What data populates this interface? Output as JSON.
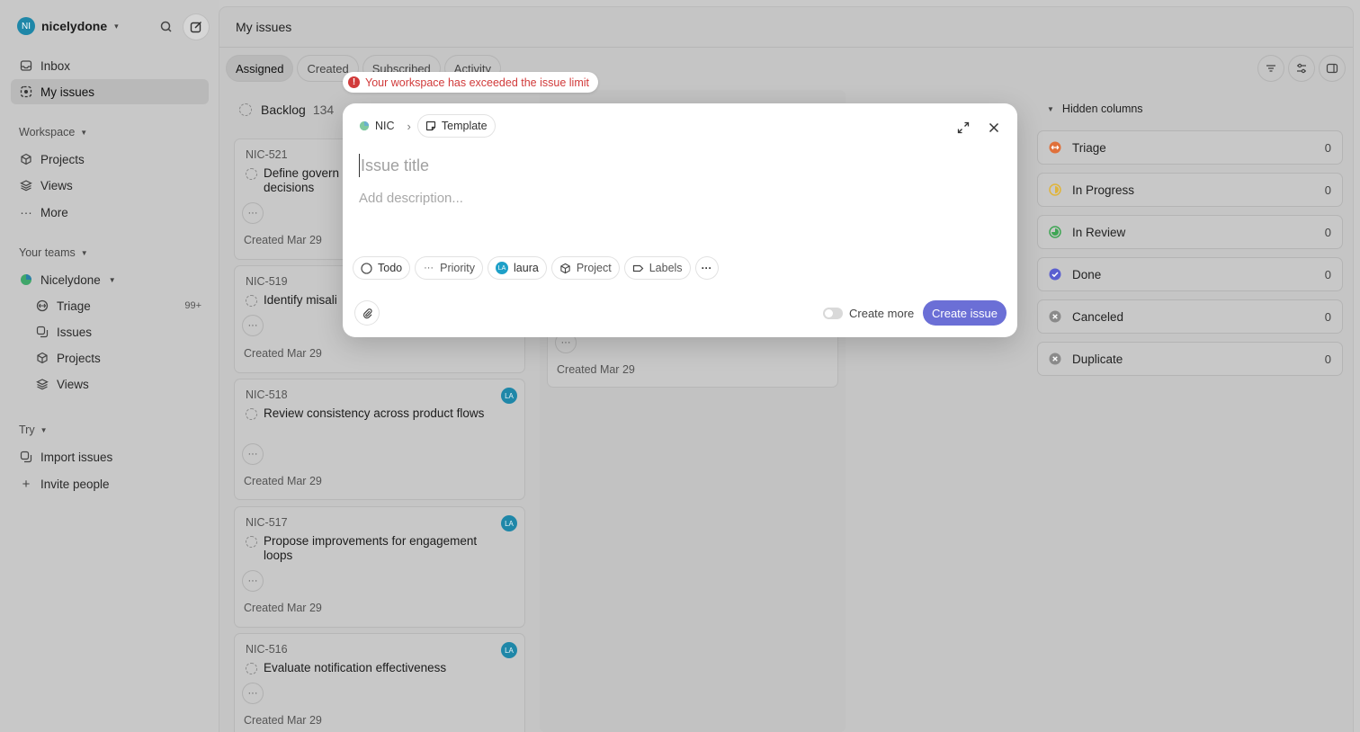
{
  "workspace": {
    "avatar": "NI",
    "name": "nicelydone"
  },
  "sidebar": {
    "top": [
      {
        "label": "Inbox"
      },
      {
        "label": "My issues"
      }
    ],
    "workspace_section": {
      "label": "Workspace",
      "items": [
        {
          "label": "Projects"
        },
        {
          "label": "Views"
        },
        {
          "label": "More"
        }
      ]
    },
    "teams_section": {
      "label": "Your teams",
      "team": "Nicelydone",
      "items": [
        {
          "label": "Triage",
          "badge": "99+"
        },
        {
          "label": "Issues"
        },
        {
          "label": "Projects"
        },
        {
          "label": "Views"
        }
      ]
    },
    "try_section": {
      "label": "Try",
      "items": [
        {
          "label": "Import issues"
        },
        {
          "label": "Invite people"
        }
      ]
    }
  },
  "main": {
    "title": "My issues",
    "tabs": [
      {
        "label": "Assigned"
      },
      {
        "label": "Created"
      },
      {
        "label": "Subscribed"
      },
      {
        "label": "Activity"
      }
    ],
    "backlog": {
      "label": "Backlog",
      "count": "134"
    },
    "cards": [
      {
        "id": "NIC-521",
        "title": "Define governance decisions",
        "title_visible": "Define govern",
        "title_line2": "decisions",
        "date": "Created Mar 29",
        "avatar": ""
      },
      {
        "id": "NIC-519",
        "title_visible": "Identify misali",
        "date": "Created Mar 29",
        "avatar": ""
      },
      {
        "id": "NIC-518",
        "title": "Review consistency across product flows",
        "date": "Created Mar 29",
        "avatar": "LA"
      },
      {
        "id": "NIC-517",
        "title": "Propose improvements for engagement loops",
        "date": "Created Mar 29",
        "avatar": "LA"
      },
      {
        "id": "NIC-516",
        "title": "Evaluate notification effectiveness",
        "date": "Created Mar 29",
        "avatar": "LA"
      }
    ],
    "col2_card_date": "Created Mar 29",
    "hidden_columns": {
      "label": "Hidden columns",
      "items": [
        {
          "label": "Triage",
          "count": "0",
          "color": "#e0703a"
        },
        {
          "label": "In Progress",
          "count": "0",
          "color": "#e0b43a"
        },
        {
          "label": "In Review",
          "count": "0",
          "color": "#3fa654"
        },
        {
          "label": "Done",
          "count": "0",
          "color": "#5a5fd0"
        },
        {
          "label": "Canceled",
          "count": "0",
          "color": "#8a8a8a"
        },
        {
          "label": "Duplicate",
          "count": "0",
          "color": "#8a8a8a"
        }
      ]
    }
  },
  "alert": {
    "text": "Your workspace has exceeded the issue limit",
    "color": "#d13a3a"
  },
  "modal": {
    "team": "NIC",
    "template": "Template",
    "title_placeholder": "Issue title",
    "description_placeholder": "Add description...",
    "props": {
      "status": "Todo",
      "priority": "Priority",
      "assignee_avatar": "LA",
      "assignee": "laura",
      "project": "Project",
      "labels": "Labels"
    },
    "create_more": "Create more",
    "create_button": "Create issue",
    "accent": "#6b6fd6"
  }
}
